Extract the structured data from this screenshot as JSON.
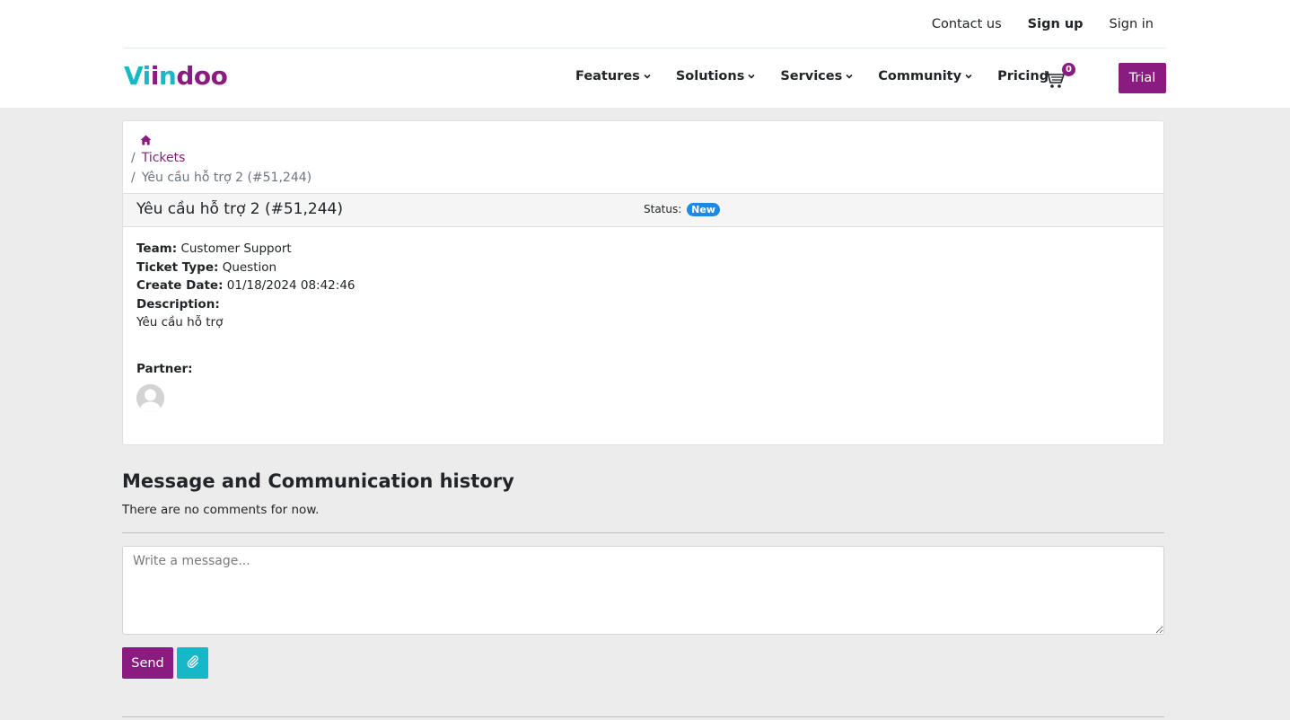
{
  "top_links": {
    "contact": "Contact us",
    "signup": "Sign up",
    "signin": "Sign in"
  },
  "logo": {
    "part1": "Vi",
    "part2": "i",
    "part3": "n",
    "part4": "doo"
  },
  "nav": {
    "features": "Features",
    "solutions": "Solutions",
    "services": "Services",
    "community": "Community",
    "pricing": "Pricing",
    "cart_count": "0",
    "trial": "Trial"
  },
  "breadcrumb": {
    "tickets": "Tickets",
    "current": "Yêu cầu hỗ trợ 2 (#51,244)",
    "sep": "/"
  },
  "ticket": {
    "title": "Yêu cầu hỗ trợ 2 (#51,244)",
    "status_label": "Status:",
    "status_value": "New",
    "team_label": "Team:",
    "team_value": "Customer Support",
    "type_label": "Ticket Type:",
    "type_value": "Question",
    "date_label": "Create Date:",
    "date_value": "01/18/2024 08:42:46",
    "desc_label": "Description:",
    "desc_value": "Yêu cầu hỗ trợ",
    "partner_label": "Partner:"
  },
  "messages": {
    "title": "Message and Communication history",
    "empty": "There are no comments for now.",
    "placeholder": "Write a message...",
    "send": "Send"
  },
  "colors": {
    "brand_purple": "#8a1b7f",
    "brand_teal": "#17b7c8",
    "status_blue": "#1e88e5"
  },
  "icons": {
    "home": "home-icon",
    "cart": "cart-icon",
    "attach": "paperclip-icon",
    "chevron": "chevron-down-icon",
    "avatar": "user-avatar-icon"
  }
}
